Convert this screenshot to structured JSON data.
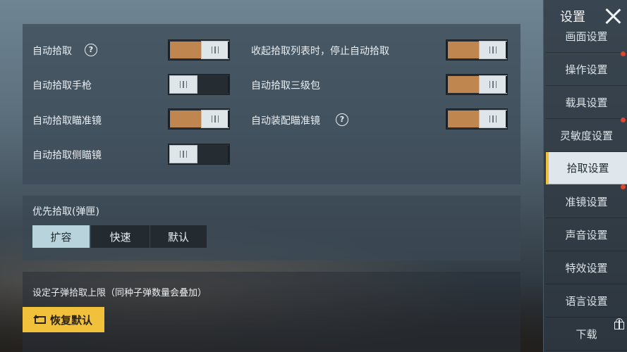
{
  "sidebar": {
    "title": "设置",
    "items": [
      {
        "label": "画面设置"
      },
      {
        "label": "操作设置"
      },
      {
        "label": "载具设置"
      },
      {
        "label": "灵敏度设置"
      },
      {
        "label": "拾取设置"
      },
      {
        "label": "准镜设置"
      },
      {
        "label": "声音设置"
      },
      {
        "label": "特效设置"
      },
      {
        "label": "语言设置"
      },
      {
        "label": "下载"
      }
    ]
  },
  "toggles": {
    "left": [
      {
        "label": "自动拾取",
        "on": true,
        "help": true
      },
      {
        "label": "自动拾取手枪",
        "on": false
      },
      {
        "label": "自动拾取瞄准镜",
        "on": true
      },
      {
        "label": "自动拾取侧瞄镜",
        "on": false
      }
    ],
    "right": [
      {
        "label": "收起拾取列表时，停止自动拾取",
        "on": true
      },
      {
        "label": "自动拾取三级包",
        "on": true
      },
      {
        "label": "自动装配瞄准镜",
        "on": true,
        "help": true
      }
    ]
  },
  "priority": {
    "title": "优先拾取(弹匣)",
    "options": [
      "扩容",
      "快速",
      "默认"
    ],
    "selected": "扩容"
  },
  "ammo": {
    "title": "设定子弹拾取上限（同种子弹数量会叠加）"
  },
  "restore_button": "恢复默认",
  "help_glyph": "?",
  "colors": {
    "accent": "#f1c13c",
    "toggle_on": "#c0864f",
    "badge": "#e0452f"
  }
}
